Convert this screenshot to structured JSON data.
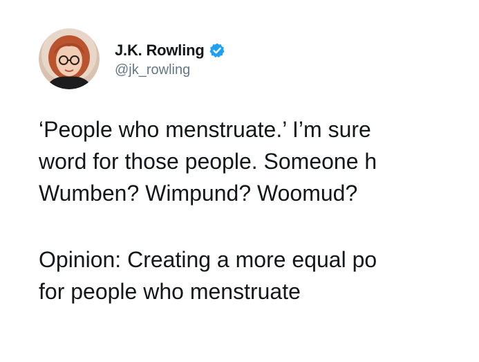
{
  "tweet": {
    "author": {
      "display_name": "J.K. Rowling",
      "handle": "@jk_rowling",
      "verified": true
    },
    "text_lines": [
      "‘People who menstruate.’ I’m sure",
      "word for those people. Someone h",
      "Wumben? Wimpund? Woomud?",
      "Opinion: Creating a more equal po",
      "for people who menstruate"
    ]
  },
  "colors": {
    "background": "#ffffff",
    "text": "#14171a",
    "handle": "#657786",
    "verified_badge": "#1da1f2"
  },
  "icons": {
    "verified": "verified-badge-icon",
    "avatar": "profile-avatar"
  }
}
